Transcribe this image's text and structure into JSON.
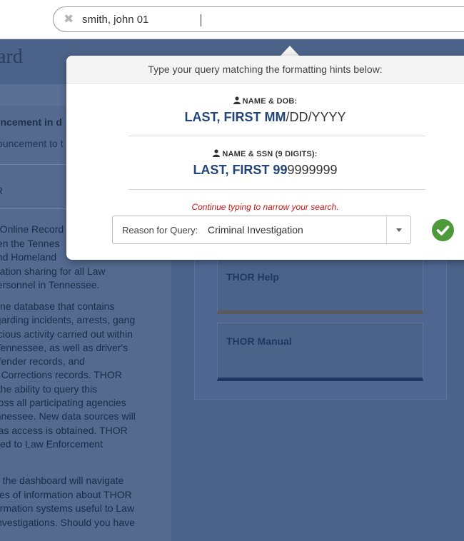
{
  "search": {
    "value": "smith, john 01",
    "clear_icon": "close-icon"
  },
  "background": {
    "page_title": "ard",
    "announcement_title": "uncement in d",
    "announcement_text": "ouncement to t",
    "section_label": "R",
    "intro_lines": "d Online Record\neen the Tennes\nand Homeland\nmation sharing for all Law\npersonnel in Tennessee.",
    "desc_lines": "nline database that contains\negarding incidents, arrests, gang\npicious activity carried out within\nf Tennessee, as well as driver's\noffender records, and\nof Corrections records. THOR\ns the ability to query this\ncross all participating agencies\nennessee. New data sources will\nd as access is obtained. THOR\nicted to Law Enforcement\nly.",
    "nav_lines": "n the dashboard will navigate\nces of information about THOR\normation systems useful to Law\ninvestigations. Should you have",
    "cards": [
      {
        "title": "THOR Help"
      },
      {
        "title": "THOR Manual"
      }
    ]
  },
  "popover": {
    "header": "Type your query matching the formatting hints below:",
    "hints": [
      {
        "title": "NAME & DOB:",
        "bold": "LAST, FIRST MM",
        "plain": "/DD/YYYY"
      },
      {
        "title": "NAME & SSN (9 DIGITS):",
        "bold": "LAST, FIRST 99",
        "plain": "9999999"
      }
    ],
    "warning": "Continue typing to narrow your search.",
    "reason_label": "Reason for Query:",
    "reason_value": "Criminal Investigation",
    "colors": {
      "accent": "#23457a",
      "warning": "#c31515",
      "ok": "#4e9a3a"
    }
  }
}
